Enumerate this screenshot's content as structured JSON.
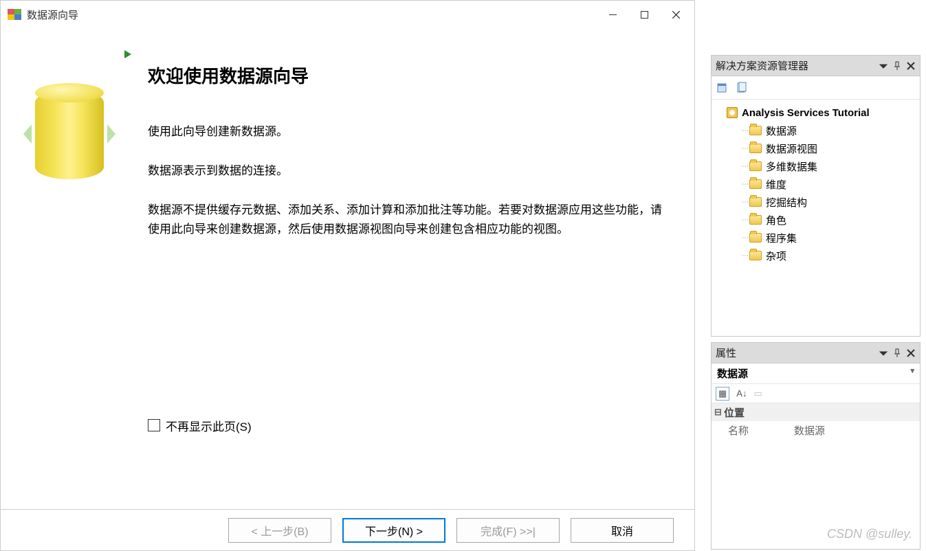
{
  "dialog": {
    "title": "数据源向导",
    "heading": "欢迎使用数据源向导",
    "para1": "使用此向导创建新数据源。",
    "para2": "数据源表示到数据的连接。",
    "para3": "数据源不提供缓存元数据、添加关系、添加计算和添加批注等功能。若要对数据源应用这些功能，请使用此向导来创建数据源，然后使用数据源视图向导来创建包含相应功能的视图。",
    "checkbox_label": "不再显示此页(S)",
    "buttons": {
      "back": "< 上一步(B)",
      "next": "下一步(N) >",
      "finish": "完成(F) >>|",
      "cancel": "取消"
    }
  },
  "solution_explorer": {
    "title": "解决方案资源管理器",
    "project": "Analysis Services Tutorial",
    "nodes": [
      "数据源",
      "数据源视图",
      "多维数据集",
      "维度",
      "挖掘结构",
      "角色",
      "程序集",
      "杂项"
    ]
  },
  "properties": {
    "title": "属性",
    "object": "数据源",
    "category": "位置",
    "rows": [
      {
        "key": "名称",
        "value": "数据源"
      }
    ]
  },
  "watermark": "CSDN @sulley."
}
